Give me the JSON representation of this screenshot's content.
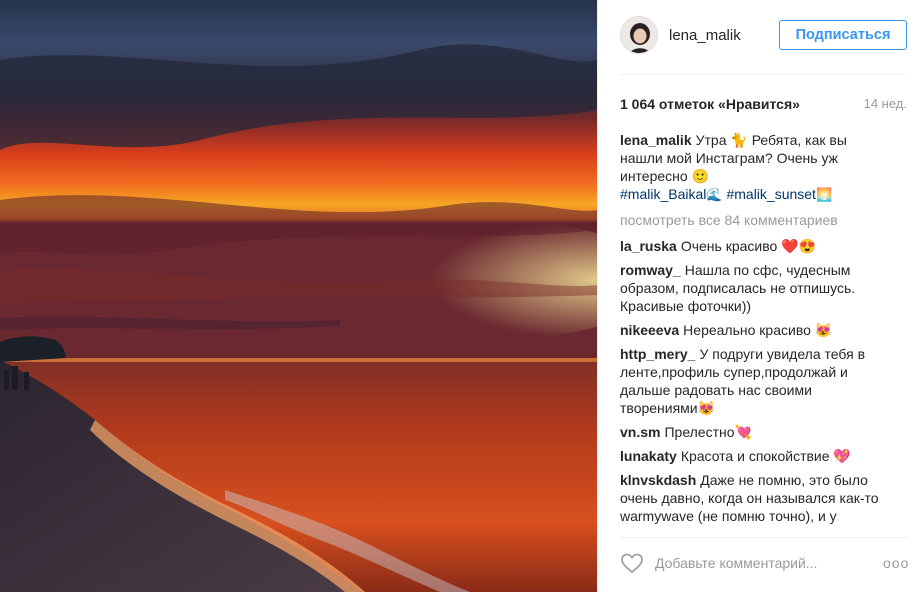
{
  "post": {
    "username": "lena_malik",
    "follow_label": "Подписаться",
    "likes_text": "1 064 отметок «Нравится»",
    "age": "14 нед.",
    "caption": {
      "user": "lena_malik",
      "text": "Утра 🐈 Ребята, как вы нашли мой Инстаграм? Очень уж интересно 🙂",
      "tags": [
        "#malik_Baikal",
        "#malik_sunset"
      ],
      "tag_emojis": [
        "🌊",
        "🌅"
      ]
    },
    "view_all": "посмотреть все 84 комментариев",
    "comments": [
      {
        "user": "la_ruska",
        "text": "Очень красиво ❤️😍"
      },
      {
        "user": "romway_",
        "text": "Нашла по сфс, чудесным образом, подписалась не отпишусь. Красивые фоточки))"
      },
      {
        "user": "nikeeeva",
        "text": "Нереально красиво 😻"
      },
      {
        "user": "http_mery_",
        "text": "У подруги увидела тебя в ленте,профиль супер,продолжай и дальше радовать нас своими творениями😻"
      },
      {
        "user": "vn.sm",
        "text": "Прелестно💘"
      },
      {
        "user": "lunakaty",
        "text": "Красота и спокойствие 💖"
      },
      {
        "user": "klnvskdash",
        "text": "Даже не помню, это было очень давно, когда он назывался как-то warmywave (не помню точно), и у"
      }
    ],
    "add_comment_placeholder": "Добавьте комментарий...",
    "more_label": "ооо"
  },
  "icons": {
    "like": "heart-outline-icon",
    "more": "more-options-icon"
  },
  "colors": {
    "accent": "#3897f0",
    "hashtag": "#003569",
    "muted": "#999999"
  }
}
